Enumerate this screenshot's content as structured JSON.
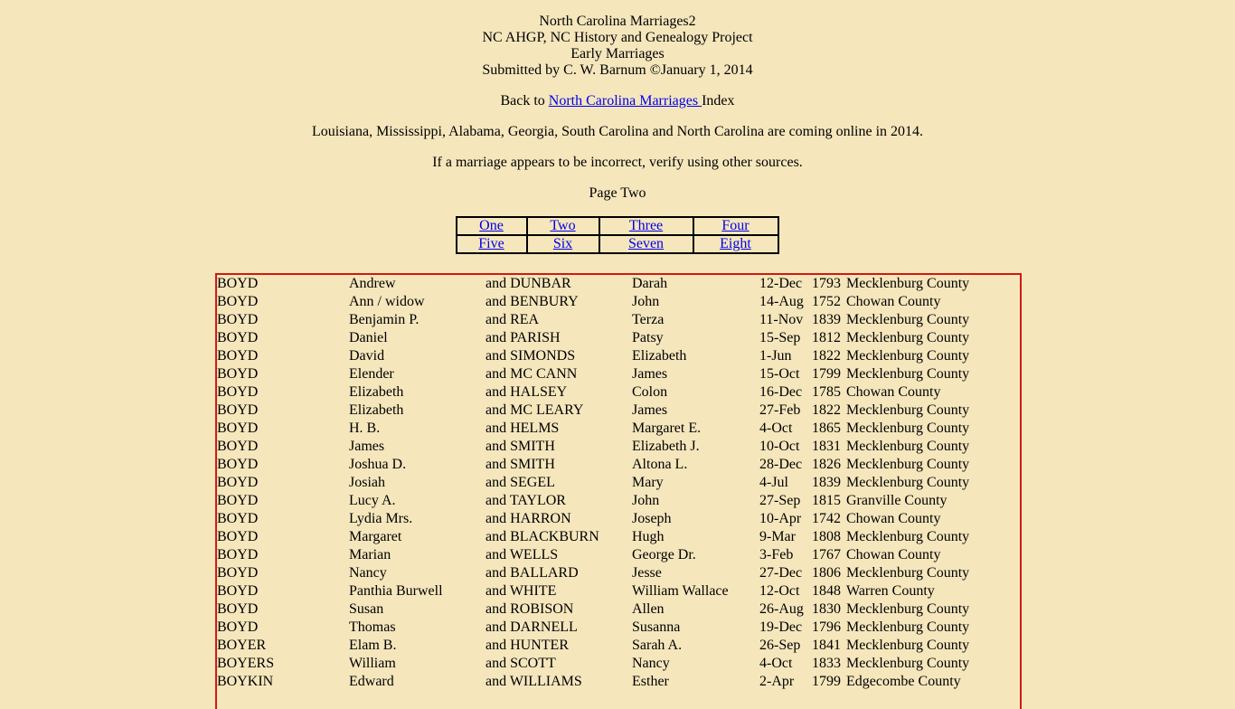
{
  "header": {
    "lines": [
      "North Carolina Marriages2",
      "NC AHGP, NC History and Genealogy Project",
      "Early Marriages",
      "Submitted by C. W. Barnum ©January 1, 2014"
    ]
  },
  "back_link": {
    "prefix": "Back to ",
    "link_text": "North Carolina Marriages ",
    "suffix": "Index"
  },
  "notice": "Louisiana, Mississippi, Alabama, Georgia, South Carolina and North Carolina are coming online in 2014.",
  "verify_note": "If a marriage appears to be incorrect, verify using other sources.",
  "page_label": "Page Two",
  "page_nav": [
    [
      "One",
      "Two",
      "Three",
      "Four"
    ],
    [
      "Five",
      "Six",
      "Seven",
      "Eight"
    ]
  ],
  "colors": {
    "background": "#f5e6bc",
    "table_border": "#d01a10",
    "link": "#0000ee"
  },
  "marriages": [
    {
      "surname": "BOYD",
      "first": "Andrew",
      "and_surname": "and DUNBAR",
      "spouse": "Darah",
      "date": "12-Dec",
      "year": "1793",
      "county": "Mecklenburg County"
    },
    {
      "surname": "BOYD",
      "first": "Ann / widow",
      "and_surname": "and BENBURY",
      "spouse": "John",
      "date": "14-Aug",
      "year": "1752",
      "county": "Chowan County"
    },
    {
      "surname": "BOYD",
      "first": "Benjamin P.",
      "and_surname": "and REA",
      "spouse": "Terza",
      "date": "11-Nov",
      "year": "1839",
      "county": "Mecklenburg County"
    },
    {
      "surname": "BOYD",
      "first": "Daniel",
      "and_surname": "and PARISH",
      "spouse": "Patsy",
      "date": "15-Sep",
      "year": "1812",
      "county": "Mecklenburg County"
    },
    {
      "surname": "BOYD",
      "first": "David",
      "and_surname": "and SIMONDS",
      "spouse": "Elizabeth",
      "date": "1-Jun",
      "year": "1822",
      "county": "Mecklenburg County"
    },
    {
      "surname": "BOYD",
      "first": "Elender",
      "and_surname": "and MC CANN",
      "spouse": "James",
      "date": "15-Oct",
      "year": "1799",
      "county": "Mecklenburg County"
    },
    {
      "surname": "BOYD",
      "first": "Elizabeth",
      "and_surname": "and HALSEY",
      "spouse": "Colon",
      "date": "16-Dec",
      "year": "1785",
      "county": "Chowan County"
    },
    {
      "surname": "BOYD",
      "first": "Elizabeth",
      "and_surname": "and MC LEARY",
      "spouse": "James",
      "date": "27-Feb",
      "year": "1822",
      "county": "Mecklenburg County"
    },
    {
      "surname": "BOYD",
      "first": "H. B.",
      "and_surname": "and HELMS",
      "spouse": "Margaret E.",
      "date": "4-Oct",
      "year": "1865",
      "county": "Mecklenburg County"
    },
    {
      "surname": "BOYD",
      "first": "James",
      "and_surname": "and SMITH",
      "spouse": "Elizabeth J.",
      "date": "10-Oct",
      "year": "1831",
      "county": "Mecklenburg County"
    },
    {
      "surname": "BOYD",
      "first": "Joshua D.",
      "and_surname": "and SMITH",
      "spouse": "Altona L.",
      "date": "28-Dec",
      "year": "1826",
      "county": "Mecklenburg County"
    },
    {
      "surname": "BOYD",
      "first": "Josiah",
      "and_surname": "and SEGEL",
      "spouse": "Mary",
      "date": "4-Jul",
      "year": "1839",
      "county": "Mecklenburg County"
    },
    {
      "surname": "BOYD",
      "first": "Lucy A.",
      "and_surname": "and TAYLOR",
      "spouse": "John",
      "date": "27-Sep",
      "year": "1815",
      "county": "Granville County"
    },
    {
      "surname": "BOYD",
      "first": "Lydia Mrs.",
      "and_surname": "and HARRON",
      "spouse": "Joseph",
      "date": "10-Apr",
      "year": "1742",
      "county": "Chowan County"
    },
    {
      "surname": "BOYD",
      "first": "Margaret",
      "and_surname": "and BLACKBURN",
      "spouse": "Hugh",
      "date": "9-Mar",
      "year": "1808",
      "county": "Mecklenburg County"
    },
    {
      "surname": "BOYD",
      "first": "Marian",
      "and_surname": "and WELLS",
      "spouse": "George Dr.",
      "date": "3-Feb",
      "year": "1767",
      "county": "Chowan County"
    },
    {
      "surname": "BOYD",
      "first": "Nancy",
      "and_surname": "and BALLARD",
      "spouse": "Jesse",
      "date": "27-Dec",
      "year": "1806",
      "county": "Mecklenburg County"
    },
    {
      "surname": "BOYD",
      "first": "Panthia Burwell",
      "and_surname": "and WHITE",
      "spouse": "William Wallace",
      "date": "12-Oct",
      "year": "1848",
      "county": "Warren County"
    },
    {
      "surname": "BOYD",
      "first": "Susan",
      "and_surname": "and ROBISON",
      "spouse": "Allen",
      "date": "26-Aug",
      "year": "1830",
      "county": "Mecklenburg County"
    },
    {
      "surname": "BOYD",
      "first": "Thomas",
      "and_surname": "and DARNELL",
      "spouse": "Susanna",
      "date": "19-Dec",
      "year": "1796",
      "county": "Mecklenburg County"
    },
    {
      "surname": "BOYER",
      "first": "Elam B.",
      "and_surname": "and HUNTER",
      "spouse": "Sarah A.",
      "date": "26-Sep",
      "year": "1841",
      "county": "Mecklenburg County"
    },
    {
      "surname": "BOYERS",
      "first": "William",
      "and_surname": "and SCOTT",
      "spouse": "Nancy",
      "date": "4-Oct",
      "year": "1833",
      "county": "Mecklenburg County"
    },
    {
      "surname": "BOYKIN",
      "first": "Edward",
      "and_surname": "and WILLIAMS",
      "spouse": "Esther",
      "date": "2-Apr",
      "year": "1799",
      "county": "Edgecombe County"
    }
  ]
}
